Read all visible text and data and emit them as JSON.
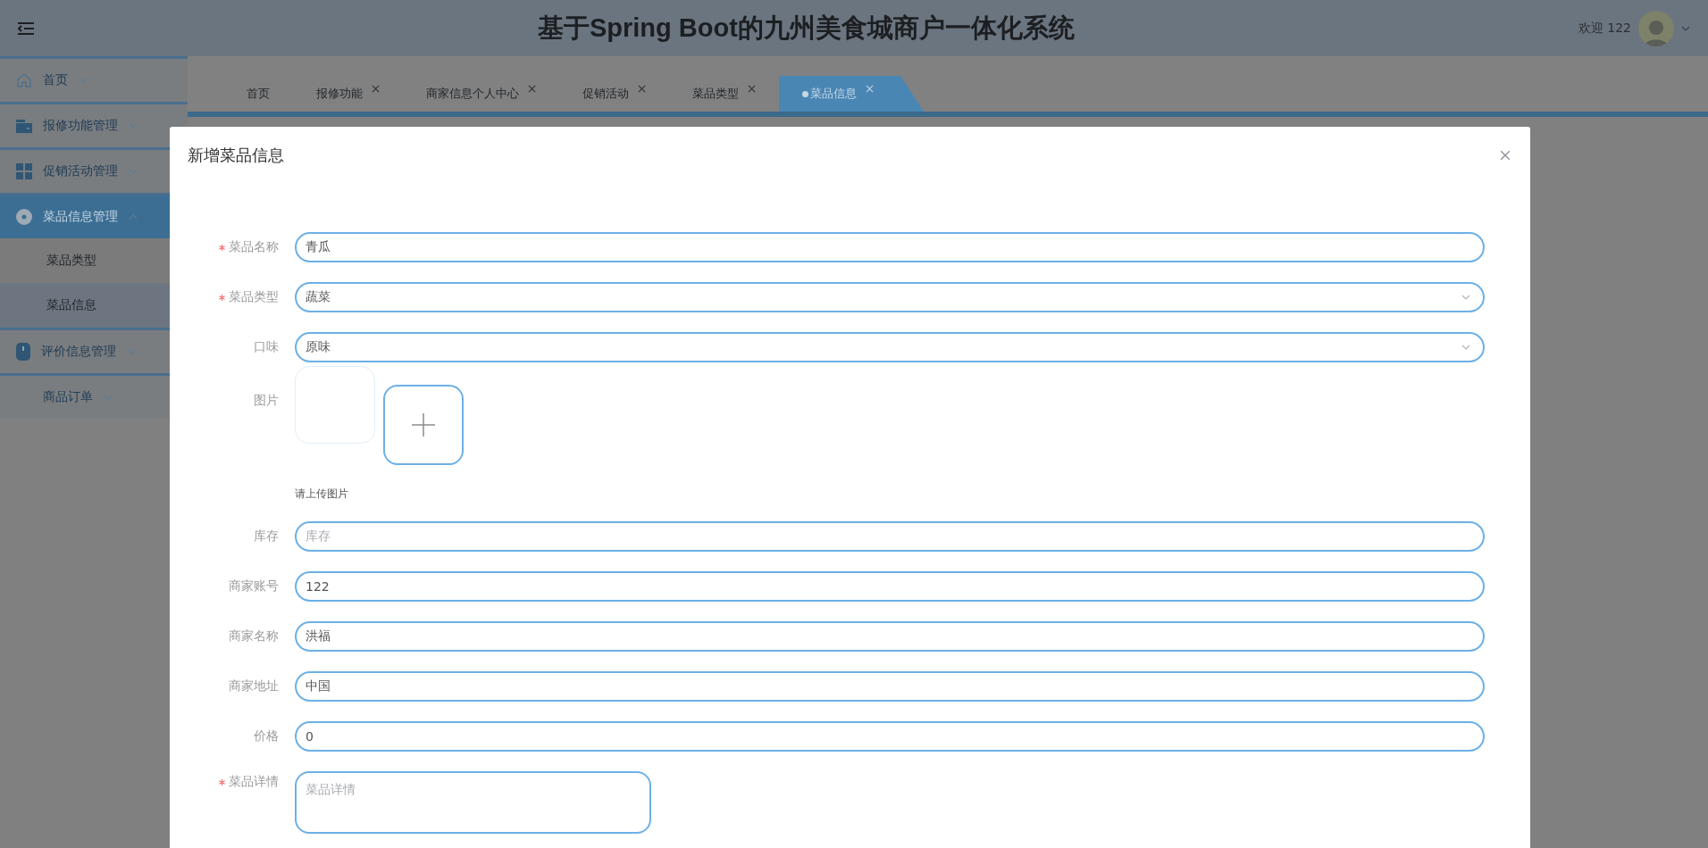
{
  "header": {
    "title": "基于Spring Boot的九州美食城商户一体化系统",
    "welcome": "欢迎 122"
  },
  "sidebar": {
    "items": [
      {
        "label": "首页",
        "expanded": false,
        "selected": false
      },
      {
        "label": "报修功能管理",
        "expanded": false,
        "selected": false
      },
      {
        "label": "促销活动管理",
        "expanded": false,
        "selected": false
      },
      {
        "label": "菜品信息管理",
        "expanded": true,
        "selected": true,
        "children": [
          {
            "label": "菜品类型",
            "selected": false
          },
          {
            "label": "菜品信息",
            "selected": true
          }
        ]
      },
      {
        "label": "评价信息管理",
        "expanded": false,
        "selected": false
      },
      {
        "label": "商品订单",
        "expanded": false,
        "selected": false
      }
    ]
  },
  "tabs": [
    {
      "label": "首页",
      "selected": false,
      "closable": false
    },
    {
      "label": "报修功能",
      "selected": false,
      "closable": true
    },
    {
      "label": "商家信息个人中心",
      "selected": false,
      "closable": true
    },
    {
      "label": "促销活动",
      "selected": false,
      "closable": true
    },
    {
      "label": "菜品类型",
      "selected": false,
      "closable": true
    },
    {
      "label": "菜品信息",
      "selected": true,
      "closable": true
    }
  ],
  "dialog": {
    "title": "新增菜品信息",
    "fields": [
      {
        "kind": "text",
        "label": "菜品名称",
        "required": true,
        "value": "青瓜"
      },
      {
        "kind": "select",
        "label": "菜品类型",
        "required": true,
        "value": "蔬菜"
      },
      {
        "kind": "select",
        "label": "口味",
        "required": false,
        "value": "原味"
      },
      {
        "kind": "upload",
        "label": "图片",
        "required": false,
        "hint": "请上传图片"
      },
      {
        "kind": "text",
        "label": "库存",
        "required": false,
        "placeholder": "库存"
      },
      {
        "kind": "text",
        "label": "商家账号",
        "required": false,
        "value": "122"
      },
      {
        "kind": "text",
        "label": "商家名称",
        "required": false,
        "value": "洪福"
      },
      {
        "kind": "text",
        "label": "商家地址",
        "required": false,
        "value": "中国"
      },
      {
        "kind": "text",
        "label": "价格",
        "required": false,
        "value": "0"
      },
      {
        "kind": "textarea",
        "label": "菜品详情",
        "required": true,
        "placeholder": "菜品详情"
      }
    ]
  }
}
